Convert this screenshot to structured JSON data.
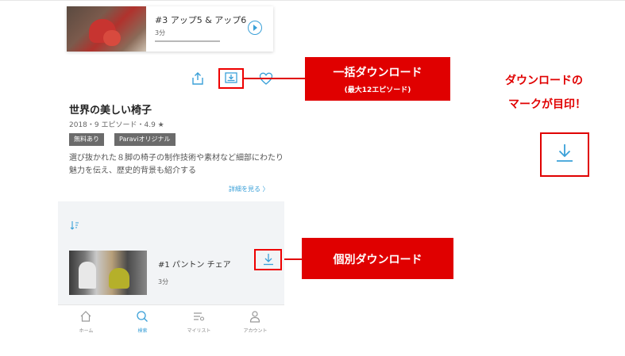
{
  "top_episode": {
    "title": "#3 アップ5 & アップ6",
    "duration": "3分",
    "progress_percent": 100
  },
  "actions": {
    "share_icon": "share-icon",
    "download_all_icon": "download-all-icon",
    "favorite_icon": "heart-icon"
  },
  "callouts": {
    "bulk_title": "一括ダウンロード",
    "bulk_sub": "(最大12エピソード)",
    "individual": "個別ダウンロード",
    "mark_line1": "ダウンロードの",
    "mark_line2": "マークが目印！",
    "color": "#e00000"
  },
  "program": {
    "title": "世界の美しい椅子",
    "meta": "2018・9 エピソード・4.9 ★",
    "tags": [
      "無料あり",
      "Paraviオリジナル"
    ],
    "description": "選び抜かれた８脚の椅子の制作技術や素材など細部にわたり魅力を伝え、歴史的背景も紹介する",
    "more_link": "詳細を見る 〉"
  },
  "episode_list": {
    "sort_icon": "sort-icon",
    "items": [
      {
        "title": "#1 パントン チェア",
        "duration": "3分",
        "download_icon": "download-icon"
      }
    ]
  },
  "bottom_nav": [
    {
      "label": "ホーム",
      "icon": "home-icon",
      "active": false
    },
    {
      "label": "検索",
      "icon": "search-icon",
      "active": true
    },
    {
      "label": "マイリスト",
      "icon": "mylist-icon",
      "active": false
    },
    {
      "label": "アカウント",
      "icon": "account-icon",
      "active": false
    }
  ],
  "colors": {
    "accent": "#3aa0d8",
    "tag_bg": "#6b6b6b",
    "highlight": "#e00000"
  }
}
